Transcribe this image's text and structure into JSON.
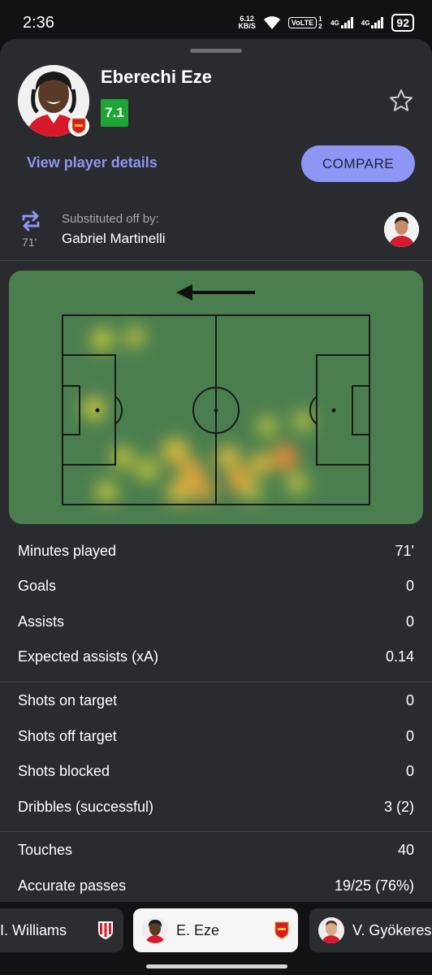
{
  "status_bar": {
    "time": "2:36",
    "speed_value": "6.12",
    "speed_unit": "KB/S",
    "volte": "VoLTE",
    "sim_slots": "1 2",
    "net1": "4G",
    "net2": "4G",
    "battery": "92"
  },
  "player": {
    "name": "Eberechi Eze",
    "rating": "7.1",
    "rating_color": "#1fa535",
    "view_details_label": "View player details",
    "compare_label": "COMPARE"
  },
  "substitution": {
    "label": "Substituted off by:",
    "minute": "71'",
    "replacement_name": "Gabriel Martinelli"
  },
  "heatmap": {
    "pitch_color": "#4a7e4f",
    "direction": "attacking-left"
  },
  "stats_groups": [
    [
      {
        "label": "Minutes played",
        "value": "71'"
      },
      {
        "label": "Goals",
        "value": "0"
      },
      {
        "label": "Assists",
        "value": "0"
      },
      {
        "label": "Expected assists (xA)",
        "value": "0.14"
      }
    ],
    [
      {
        "label": "Shots on target",
        "value": "0"
      },
      {
        "label": "Shots off target",
        "value": "0"
      },
      {
        "label": "Shots blocked",
        "value": "0"
      },
      {
        "label": "Dribbles (successful)",
        "value": "3 (2)"
      }
    ],
    [
      {
        "label": "Touches",
        "value": "40"
      },
      {
        "label": "Accurate passes",
        "value": "19/25 (76%)"
      }
    ]
  ],
  "player_tabs": [
    {
      "name": "I. Williams",
      "active": false
    },
    {
      "name": "E. Eze",
      "active": true
    },
    {
      "name": "V. Gyökeres",
      "active": false
    }
  ],
  "colors": {
    "accent": "#8d96f5",
    "sheet_bg": "#2a2b2f",
    "secondary_text": "#a8a9ad"
  }
}
